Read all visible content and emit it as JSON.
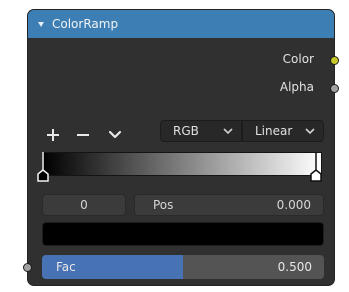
{
  "node": {
    "title": "ColorRamp",
    "header_color": "#3d7fb5",
    "outputs": [
      {
        "label": "Color",
        "socket_color": "#c7c729"
      },
      {
        "label": "Alpha",
        "socket_color": "#a1a1a1"
      }
    ]
  },
  "toolbar": {
    "add_icon": "plus-icon",
    "remove_icon": "minus-icon",
    "menu_icon": "chevron-down-icon",
    "color_mode": "RGB",
    "interpolation": "Linear"
  },
  "ramp": {
    "stops": [
      {
        "position": 0.0,
        "color": "#000000",
        "active": true
      },
      {
        "position": 1.0,
        "color": "#ffffff",
        "active": false
      }
    ]
  },
  "active_stop": {
    "index": "0",
    "pos_label": "Pos",
    "pos_value": "0.000",
    "color": "#000000"
  },
  "fac": {
    "label": "Fac",
    "value_text": "0.500",
    "value": 0.5,
    "fill_color": "#4772b3"
  }
}
